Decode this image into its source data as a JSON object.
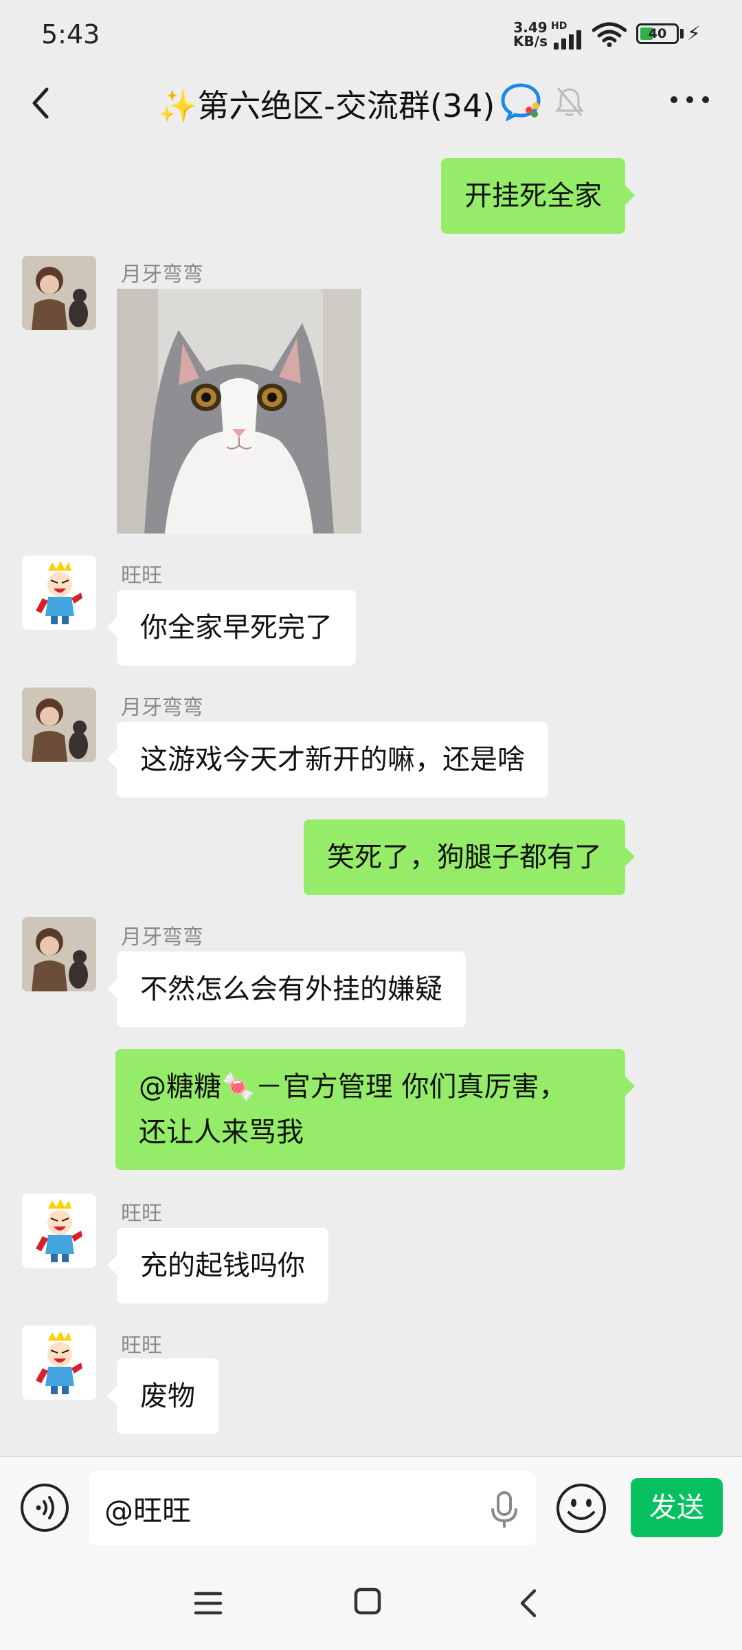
{
  "status_bar": {
    "time": "5:43",
    "net_speed_value": "3.49",
    "net_speed_unit": "KB/s",
    "network_type": "HD",
    "battery_level": "40",
    "icons": [
      "signal-icon",
      "wifi-icon",
      "battery-icon",
      "charging-bolt-icon"
    ]
  },
  "header": {
    "title": "✨第六绝区-交流群(34)",
    "icons": [
      "back-icon",
      "group-chat-icon",
      "mute-bell-icon",
      "more-icon"
    ]
  },
  "messages": [
    {
      "direction": "out",
      "text": "开挂死全家"
    },
    {
      "direction": "in",
      "sender": "月牙弯弯",
      "type": "image",
      "image": "cat-photo"
    },
    {
      "direction": "in",
      "sender": "旺旺",
      "text": "你全家早死完了"
    },
    {
      "direction": "in",
      "sender": "月牙弯弯",
      "text": "这游戏今天才新开的嘛，还是啥"
    },
    {
      "direction": "out",
      "text": "笑死了，狗腿子都有了"
    },
    {
      "direction": "in",
      "sender": "月牙弯弯",
      "text": "不然怎么会有外挂的嫌疑"
    },
    {
      "direction": "out",
      "text_line1": "@糖糖🍬－官方管理  你们真厉害，",
      "text_line2": "还让人来骂我"
    },
    {
      "direction": "in",
      "sender": "旺旺",
      "text": "充的起钱吗你"
    },
    {
      "direction": "in",
      "sender": "旺旺",
      "text": "废物"
    }
  ],
  "input_bar": {
    "value": "@旺旺",
    "send_label": "发送",
    "icons": [
      "voice-icon",
      "mic-icon",
      "emoji-icon"
    ]
  },
  "colors": {
    "background": "#ededed",
    "outgoing_bubble": "#95ec69",
    "incoming_bubble": "#ffffff",
    "send_button": "#07c160"
  }
}
